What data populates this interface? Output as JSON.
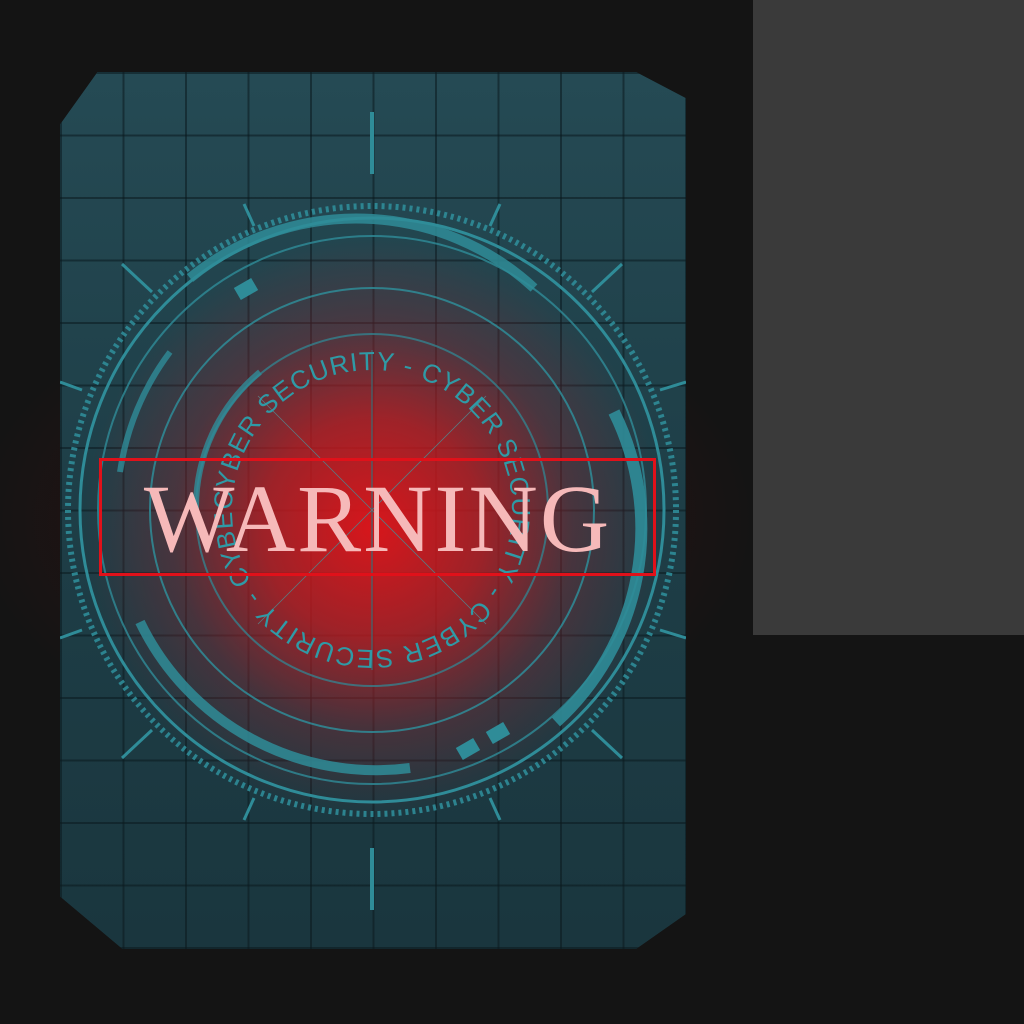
{
  "ring_text": "CYBER SECURITY  -  CYBER SECURITY  -  CYBER SECURITY  -  CYBER SECURITY  - ",
  "warning": "WARNING",
  "colors": {
    "background": "#141414",
    "side_panel": "#3a3a3a",
    "card": "#1f3d46",
    "accent_teal": "#2f8c98",
    "alert_red": "#e0111a",
    "warning_text": "#f6b9b9"
  },
  "icons": {
    "card": "cyber-security-emblem"
  }
}
